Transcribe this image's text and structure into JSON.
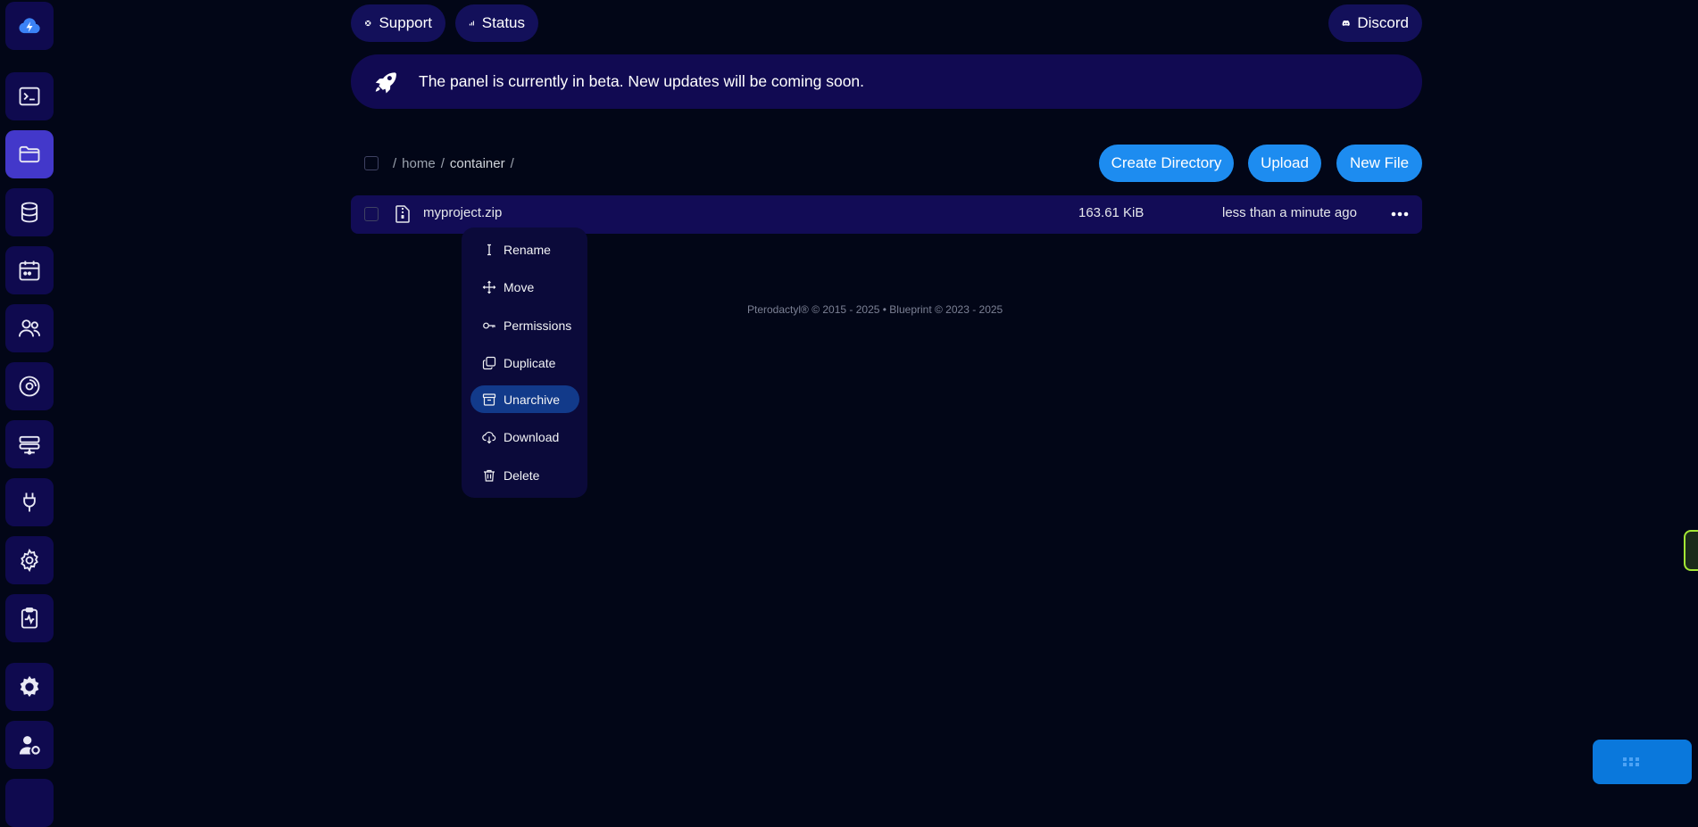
{
  "top_nav": {
    "support_label": "Support",
    "status_label": "Status",
    "discord_label": "Discord"
  },
  "banner": {
    "message": "The panel is currently in beta. New updates will be coming soon."
  },
  "breadcrumb": {
    "parts": [
      "home",
      "container"
    ]
  },
  "actions": {
    "create_directory": "Create Directory",
    "upload": "Upload",
    "new_file": "New File"
  },
  "files": [
    {
      "name": "myproject.zip",
      "size": "163.61 KiB",
      "modified": "less than a minute ago"
    }
  ],
  "context_menu": {
    "items": [
      {
        "label": "Rename",
        "icon": "text-cursor-icon"
      },
      {
        "label": "Move",
        "icon": "move-arrows-icon"
      },
      {
        "label": "Permissions",
        "icon": "key-icon"
      },
      {
        "label": "Duplicate",
        "icon": "copy-icon"
      },
      {
        "label": "Unarchive",
        "icon": "archive-box-icon",
        "highlighted": true
      },
      {
        "label": "Download",
        "icon": "cloud-download-icon"
      },
      {
        "label": "Delete",
        "icon": "trash-icon"
      }
    ]
  },
  "footer": {
    "text": "Pterodactyl® © 2015 - 2025  •  Blueprint © 2023 - 2025"
  },
  "sidebar": {
    "items": [
      {
        "icon": "cloud-lightning-logo-icon"
      },
      {
        "icon": "terminal-icon"
      },
      {
        "icon": "folder-icon",
        "active": true
      },
      {
        "icon": "database-icon"
      },
      {
        "icon": "calendar-icon"
      },
      {
        "icon": "users-icon"
      },
      {
        "icon": "disc-backup-icon"
      },
      {
        "icon": "network-icon"
      },
      {
        "icon": "plug-icon"
      },
      {
        "icon": "settings-gear-icon"
      },
      {
        "icon": "activity-clipboard-icon"
      },
      {
        "icon": "admin-gear-icon"
      },
      {
        "icon": "account-user-icon"
      }
    ]
  },
  "colors": {
    "background": "#020617",
    "panel": "#120c56",
    "accent": "#1d8cf0",
    "sidebar_active": "#4338ca",
    "menu_highlight": "#123a8a"
  }
}
